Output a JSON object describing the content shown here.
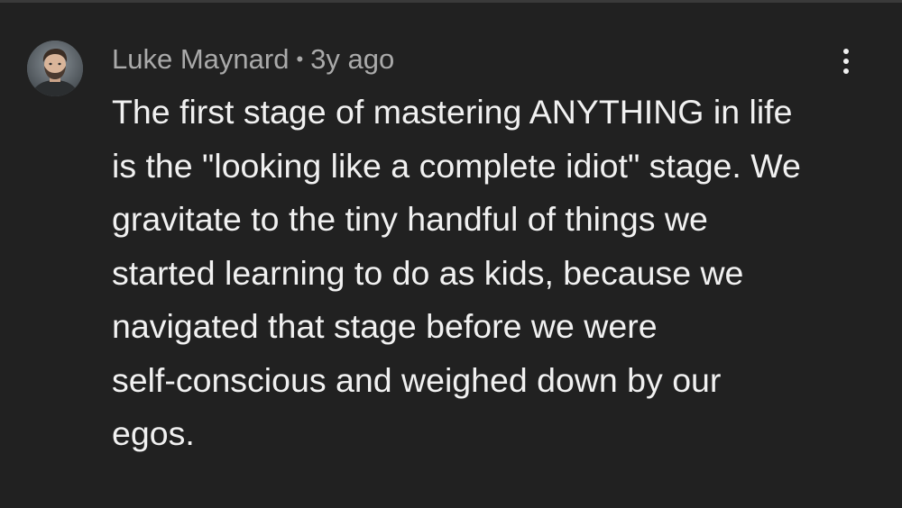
{
  "comment": {
    "author": "Luke Maynard",
    "separator": "•",
    "timestamp": "3y ago",
    "text": "The first stage of mastering ANYTHING in life\nis the \"looking like a complete idiot\" stage. We\ngravitate to the tiny handful of things we\nstarted learning to do as kids, because we\nnavigated that stage before we were\nself-conscious and weighed down by our\negos.",
    "avatar_icon": "user-avatar",
    "menu_icon": "more-vertical-icon"
  },
  "colors": {
    "background": "#212121",
    "meta_text": "#aaaaaa",
    "body_text": "#f1f1f1",
    "divider": "#3a3a3a"
  }
}
